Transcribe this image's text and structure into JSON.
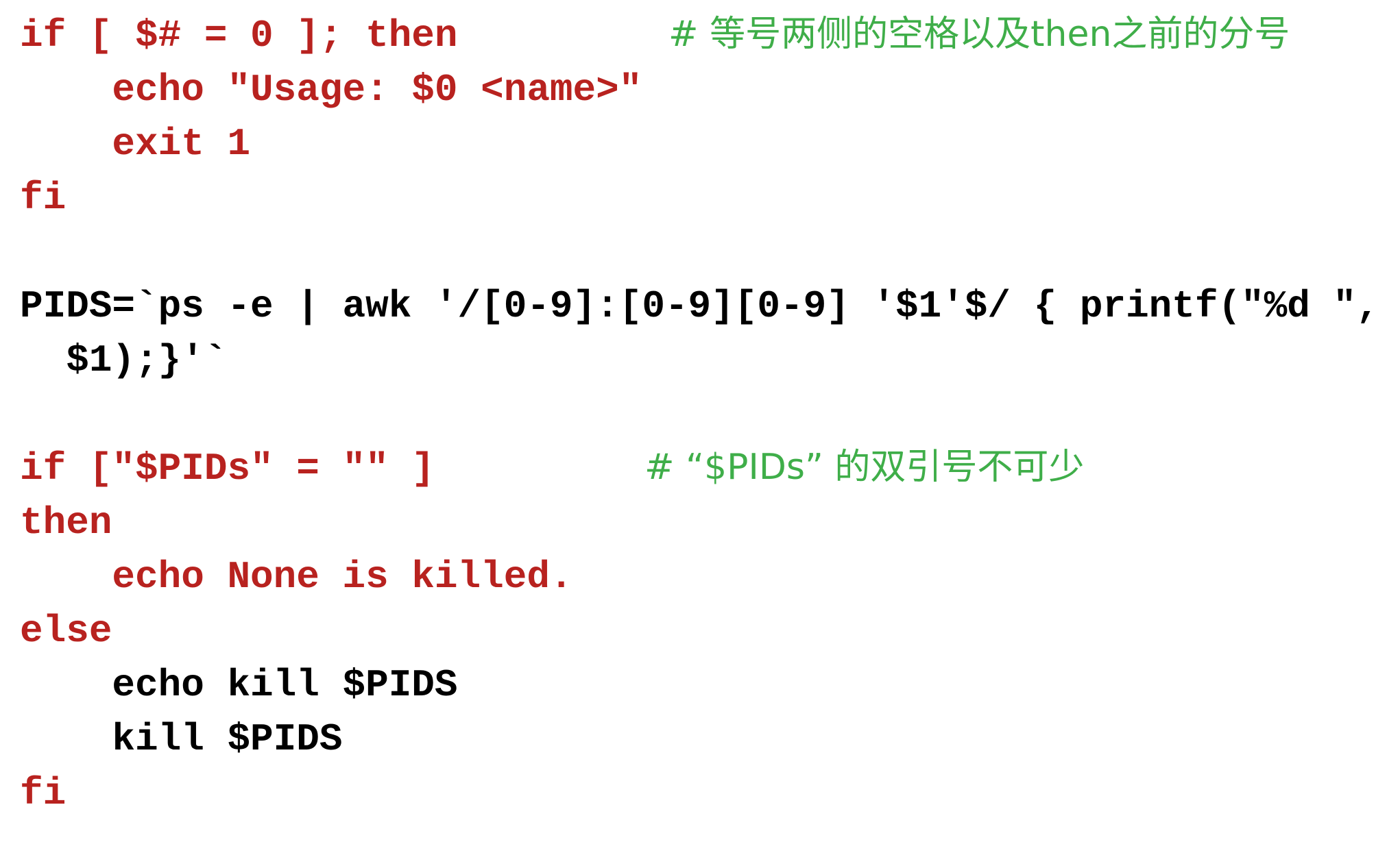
{
  "colors": {
    "keyword_red": "#b8221f",
    "plain_black": "#000000",
    "comment_green": "#3fae49"
  },
  "lines": {
    "l1": "if [ $# = 0 ]; then",
    "l2": "    echo \"Usage: $0 <name>\"",
    "l3": "    exit 1",
    "l4": "fi",
    "l5": "PIDS=`ps -e | awk '/[0-9]:[0-9][0-9] '$1'$/ { printf(\"%d \",",
    "l6": "  $1);}'`",
    "l7": "if [\"$PIDs\" = \"\" ]",
    "l8": "then",
    "l9": "    echo None is killed.",
    "l10": "else",
    "l11": "    echo kill $PIDS",
    "l12": "    kill $PIDS",
    "l13": "fi"
  },
  "comments": {
    "c1": "# 等号两侧的空格以及then之前的分号",
    "c2": "# “$PIDs” 的双引号不可少"
  }
}
